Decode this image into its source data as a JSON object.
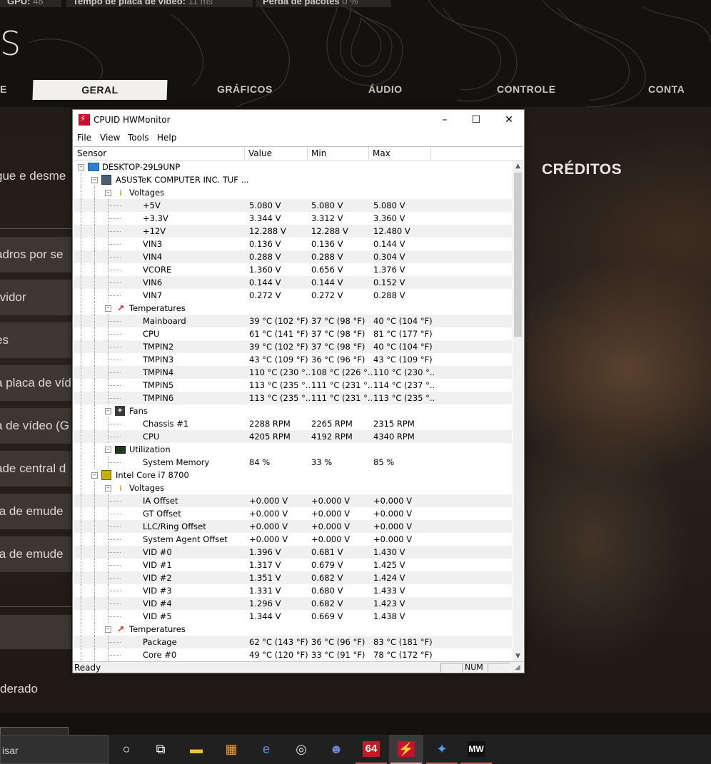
{
  "game": {
    "stats": [
      {
        "label": "GPU:",
        "value": "48"
      },
      {
        "label": "Tempo de placa de vídeo:",
        "value": "11 ms"
      },
      {
        "label": "Perda de pacotes",
        "value": "0 %"
      }
    ],
    "title_fragment": "S",
    "tabs": {
      "left_fragment": "E",
      "active": "GERAL",
      "graficos": "GRÁFICOS",
      "audio": "ÁUDIO",
      "controle": "CONTROLE",
      "conta": "CONTA"
    },
    "creditos": "CRÉDITOS",
    "sidebar": [
      "gue e desme",
      "adros por se",
      "rvidor",
      "es",
      "a placa de víd",
      "a de vídeo (G",
      "ade central d",
      "ta de emude",
      "ta de emude"
    ],
    "moderado": "derado"
  },
  "hwmonitor": {
    "title": "CPUID HWMonitor",
    "window_buttons": {
      "minimize": "–",
      "maximize": "☐",
      "close": "✕"
    },
    "menu": [
      "File",
      "View",
      "Tools",
      "Help"
    ],
    "columns": [
      "Sensor",
      "Value",
      "Min",
      "Max"
    ],
    "rows": [
      {
        "level": 0,
        "type": "node",
        "icon": "computer-icon",
        "label": "DESKTOP-29L9UNP"
      },
      {
        "level": 1,
        "type": "node",
        "icon": "motherboard-icon",
        "label": "ASUSTeK COMPUTER INC. TUF ..."
      },
      {
        "level": 2,
        "type": "group",
        "icon": "voltage-icon",
        "label": "Voltages"
      },
      {
        "level": 3,
        "label": "+5V",
        "value": "5.080 V",
        "min": "5.080 V",
        "max": "5.080 V"
      },
      {
        "level": 3,
        "label": "+3.3V",
        "value": "3.344 V",
        "min": "3.312 V",
        "max": "3.360 V"
      },
      {
        "level": 3,
        "label": "+12V",
        "value": "12.288 V",
        "min": "12.288 V",
        "max": "12.480 V"
      },
      {
        "level": 3,
        "label": "VIN3",
        "value": "0.136 V",
        "min": "0.136 V",
        "max": "0.144 V"
      },
      {
        "level": 3,
        "label": "VIN4",
        "value": "0.288 V",
        "min": "0.288 V",
        "max": "0.304 V"
      },
      {
        "level": 3,
        "label": "VCORE",
        "value": "1.360 V",
        "min": "0.656 V",
        "max": "1.376 V"
      },
      {
        "level": 3,
        "label": "VIN6",
        "value": "0.144 V",
        "min": "0.144 V",
        "max": "0.152 V"
      },
      {
        "level": 3,
        "label": "VIN7",
        "value": "0.272 V",
        "min": "0.272 V",
        "max": "0.288 V"
      },
      {
        "level": 2,
        "type": "group",
        "icon": "temperature-icon",
        "label": "Temperatures"
      },
      {
        "level": 3,
        "label": "Mainboard",
        "value": "39 °C  (102 °F)",
        "min": "37 °C  (98 °F)",
        "max": "40 °C  (104 °F)"
      },
      {
        "level": 3,
        "label": "CPU",
        "value": "61 °C  (141 °F)",
        "min": "37 °C  (98 °F)",
        "max": "81 °C  (177 °F)"
      },
      {
        "level": 3,
        "label": "TMPIN2",
        "value": "39 °C  (102 °F)",
        "min": "37 °C  (98 °F)",
        "max": "40 °C  (104 °F)"
      },
      {
        "level": 3,
        "label": "TMPIN3",
        "value": "43 °C  (109 °F)",
        "min": "36 °C  (96 °F)",
        "max": "43 °C  (109 °F)"
      },
      {
        "level": 3,
        "label": "TMPIN4",
        "value": "110 °C  (230 °...",
        "min": "108 °C  (226 °...",
        "max": "110 °C  (230 °..."
      },
      {
        "level": 3,
        "label": "TMPIN5",
        "value": "113 °C  (235 °...",
        "min": "111 °C  (231 °...",
        "max": "114 °C  (237 °..."
      },
      {
        "level": 3,
        "label": "TMPIN6",
        "value": "113 °C  (235 °...",
        "min": "111 °C  (231 °...",
        "max": "113 °C  (235 °..."
      },
      {
        "level": 2,
        "type": "group",
        "icon": "fan-icon",
        "label": "Fans"
      },
      {
        "level": 3,
        "label": "Chassis #1",
        "value": "2288 RPM",
        "min": "2265 RPM",
        "max": "2315 RPM"
      },
      {
        "level": 3,
        "label": "CPU",
        "value": "4205 RPM",
        "min": "4192 RPM",
        "max": "4340 RPM"
      },
      {
        "level": 2,
        "type": "group",
        "icon": "utilization-icon",
        "label": "Utilization"
      },
      {
        "level": 3,
        "label": "System Memory",
        "value": "84 %",
        "min": "33 %",
        "max": "85 %"
      },
      {
        "level": 1,
        "type": "node",
        "icon": "cpu-chip-icon",
        "label": "Intel Core i7 8700"
      },
      {
        "level": 2,
        "type": "group",
        "icon": "voltage-icon",
        "label": "Voltages"
      },
      {
        "level": 3,
        "label": "IA Offset",
        "value": "+0.000 V",
        "min": "+0.000 V",
        "max": "+0.000 V"
      },
      {
        "level": 3,
        "label": "GT Offset",
        "value": "+0.000 V",
        "min": "+0.000 V",
        "max": "+0.000 V"
      },
      {
        "level": 3,
        "label": "LLC/Ring Offset",
        "value": "+0.000 V",
        "min": "+0.000 V",
        "max": "+0.000 V"
      },
      {
        "level": 3,
        "label": "System Agent Offset",
        "value": "+0.000 V",
        "min": "+0.000 V",
        "max": "+0.000 V"
      },
      {
        "level": 3,
        "label": "VID #0",
        "value": "1.396 V",
        "min": "0.681 V",
        "max": "1.430 V"
      },
      {
        "level": 3,
        "label": "VID #1",
        "value": "1.317 V",
        "min": "0.679 V",
        "max": "1.425 V"
      },
      {
        "level": 3,
        "label": "VID #2",
        "value": "1.351 V",
        "min": "0.682 V",
        "max": "1.424 V"
      },
      {
        "level": 3,
        "label": "VID #3",
        "value": "1.331 V",
        "min": "0.680 V",
        "max": "1.433 V"
      },
      {
        "level": 3,
        "label": "VID #4",
        "value": "1.296 V",
        "min": "0.682 V",
        "max": "1.423 V"
      },
      {
        "level": 3,
        "label": "VID #5",
        "value": "1.344 V",
        "min": "0.669 V",
        "max": "1.438 V"
      },
      {
        "level": 2,
        "type": "group",
        "icon": "temperature-icon",
        "label": "Temperatures"
      },
      {
        "level": 3,
        "label": "Package",
        "value": "62 °C  (143 °F)",
        "min": "36 °C  (96 °F)",
        "max": "83 °C  (181 °F)"
      },
      {
        "level": 3,
        "label": "Core #0",
        "value": "49 °C  (120 °F)",
        "min": "33 °C  (91 °F)",
        "max": "78 °C  (172 °F)"
      }
    ],
    "status": {
      "text": "Ready",
      "num": "NUM"
    }
  },
  "taskbar": {
    "search_text": "isar",
    "icons": [
      {
        "name": "cortana-icon",
        "glyph": "○"
      },
      {
        "name": "task-view-icon",
        "glyph": "⧉"
      },
      {
        "name": "file-explorer-icon",
        "glyph": "▬"
      },
      {
        "name": "microsoft-store-icon",
        "glyph": "▦"
      },
      {
        "name": "edge-browser-icon",
        "glyph": "e"
      },
      {
        "name": "obs-studio-icon",
        "glyph": "◎"
      },
      {
        "name": "discord-icon",
        "glyph": "☻"
      },
      {
        "name": "aida64-icon",
        "glyph": "64"
      },
      {
        "name": "hwmonitor-icon",
        "glyph": "⚡"
      },
      {
        "name": "battlenet-icon",
        "glyph": "✦"
      },
      {
        "name": "modern-warfare-icon",
        "glyph": "MW"
      }
    ]
  },
  "colors": {
    "hw_accent": "#c8102e",
    "taskbar_bg": "#202020",
    "game_bg": "#1b1714"
  }
}
